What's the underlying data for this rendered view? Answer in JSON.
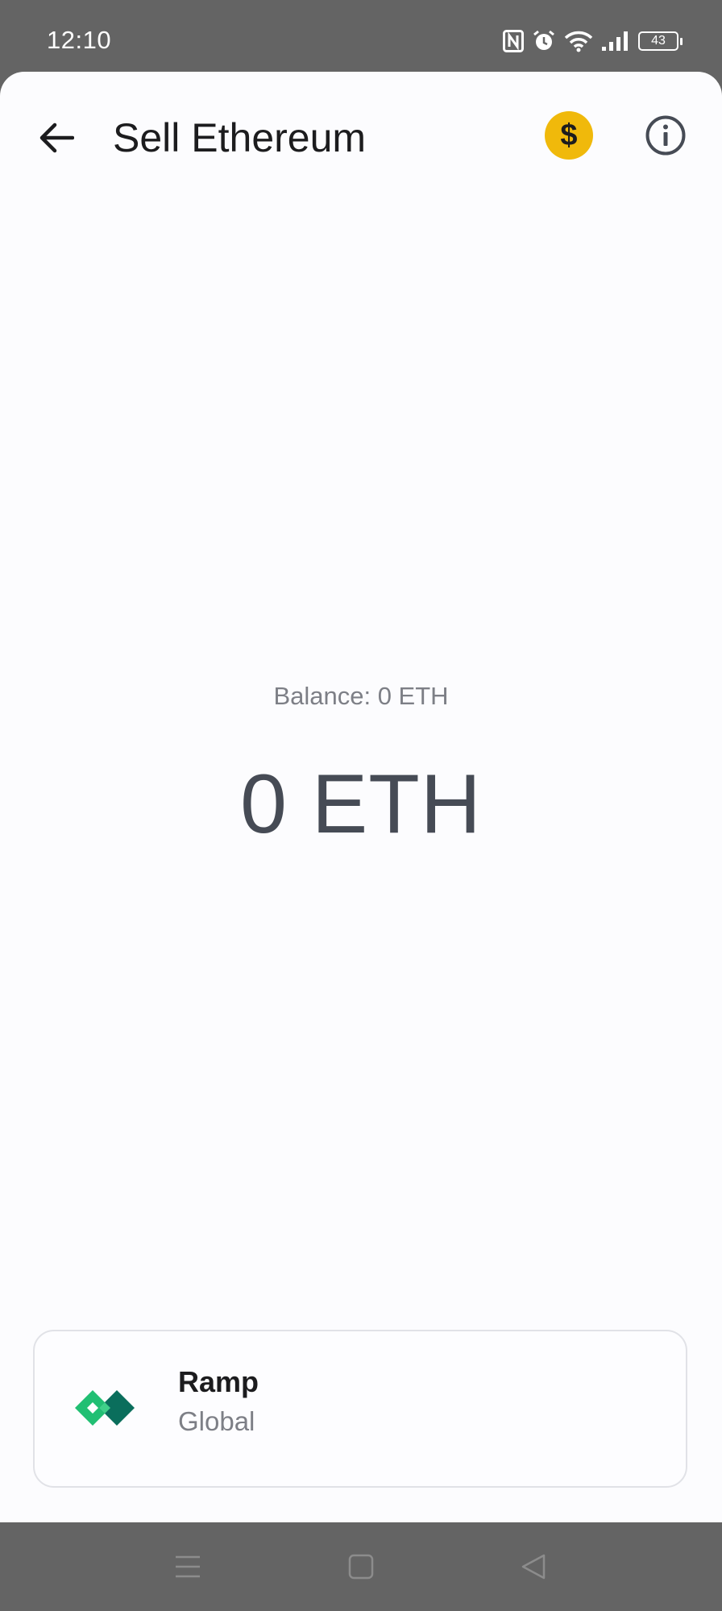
{
  "status_bar": {
    "time": "12:10",
    "battery_level": "43",
    "icons": [
      "nfc-icon",
      "alarm-icon",
      "wifi-icon",
      "signal-icon",
      "battery-icon"
    ]
  },
  "app_bar": {
    "title": "Sell Ethereum",
    "back_icon": "arrow-left-icon",
    "currency_icon": "dollar-icon",
    "currency_symbol": "$",
    "info_icon": "info-icon",
    "accent_color": "#f0b90b"
  },
  "main": {
    "balance_label": "Balance: 0 ETH",
    "amount_display": "0 ETH"
  },
  "provider": {
    "name": "Ramp",
    "region": "Global",
    "logo_icon": "ramp-logo-icon",
    "logo_colors": [
      "#21bf73",
      "#0a6e5c"
    ]
  },
  "nav_bar": {
    "icons": [
      "menu-icon",
      "home-icon",
      "back-triangle-icon"
    ]
  }
}
